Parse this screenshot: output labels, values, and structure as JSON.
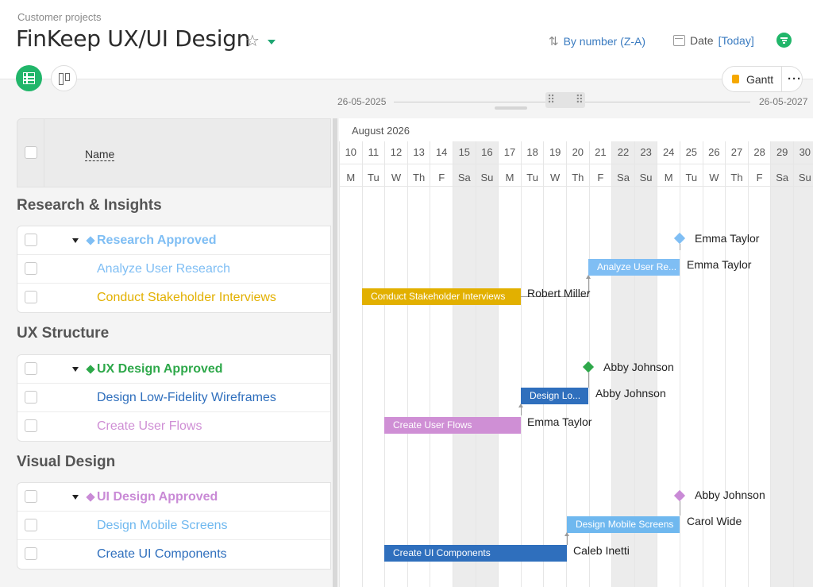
{
  "header": {
    "breadcrumb": "Customer projects",
    "title": "FinKeep UX/UI Design",
    "sort_label": "By number (Z-A)",
    "date_label": "Date",
    "date_value": "[Today]",
    "icons": {
      "star": "star-icon",
      "sort": "sort-icon",
      "calendar": "calendar-icon",
      "filter": "filter-icon"
    }
  },
  "views": {
    "gantt_label": "Gantt",
    "more_label": "···",
    "gantt_color": "#f5a800",
    "active_color": "#21b66a"
  },
  "range": {
    "start": "26-05-2025",
    "end": "26-05-2027"
  },
  "table": {
    "name_header": "Name"
  },
  "groups": [
    {
      "title": "Research & Insights",
      "milestone": {
        "label": "Research Approved",
        "color": "#7fbef4",
        "assignee": "Emma Taylor"
      },
      "tasks": [
        {
          "label": "Analyze User Research",
          "bar_label": "Analyze User Re...",
          "color": "#7fbef4",
          "assignee": "Emma Taylor"
        },
        {
          "label": "Conduct Stakeholder Interviews",
          "bar_label": "Conduct Stakeholder Interviews",
          "color": "#e2b000",
          "assignee": "Robert Miller"
        }
      ]
    },
    {
      "title": "UX Structure",
      "milestone": {
        "label": "UX Design Approved",
        "color": "#2ea84a",
        "assignee": "Abby Johnson"
      },
      "tasks": [
        {
          "label": "Design Low-Fidelity Wireframes",
          "bar_label": "Design Lo...",
          "color": "#2f6fbd",
          "assignee": "Abby Johnson"
        },
        {
          "label": "Create User Flows",
          "bar_label": "Create User Flows",
          "color": "#cf8fd5",
          "assignee": "Emma Taylor"
        }
      ]
    },
    {
      "title": "Visual Design",
      "milestone": {
        "label": "UI Design Approved",
        "color": "#c98ad6",
        "assignee": "Abby Johnson"
      },
      "tasks": [
        {
          "label": "Design Mobile Screens",
          "bar_label": "Design Mobile Screens",
          "color": "#6fb8ef",
          "assignee": "Carol Wide"
        },
        {
          "label": "Create UI Components",
          "bar_label": "Create UI Components",
          "color": "#2f6fbd",
          "assignee": "Caleb Inetti"
        }
      ]
    }
  ],
  "timeline": {
    "month": "August 2026",
    "days": [
      {
        "d": "10",
        "w": "M"
      },
      {
        "d": "11",
        "w": "Tu"
      },
      {
        "d": "12",
        "w": "W"
      },
      {
        "d": "13",
        "w": "Th"
      },
      {
        "d": "14",
        "w": "F"
      },
      {
        "d": "15",
        "w": "Sa",
        "we": true
      },
      {
        "d": "16",
        "w": "Su",
        "we": true
      },
      {
        "d": "17",
        "w": "M"
      },
      {
        "d": "18",
        "w": "Tu"
      },
      {
        "d": "19",
        "w": "W"
      },
      {
        "d": "20",
        "w": "Th"
      },
      {
        "d": "21",
        "w": "F"
      },
      {
        "d": "22",
        "w": "Sa",
        "we": true
      },
      {
        "d": "23",
        "w": "Su",
        "we": true
      },
      {
        "d": "24",
        "w": "M"
      },
      {
        "d": "25",
        "w": "Tu"
      },
      {
        "d": "26",
        "w": "W"
      },
      {
        "d": "27",
        "w": "Th"
      },
      {
        "d": "28",
        "w": "F"
      },
      {
        "d": "29",
        "w": "Sa",
        "we": true
      },
      {
        "d": "30",
        "w": "Su",
        "we": true
      }
    ]
  }
}
